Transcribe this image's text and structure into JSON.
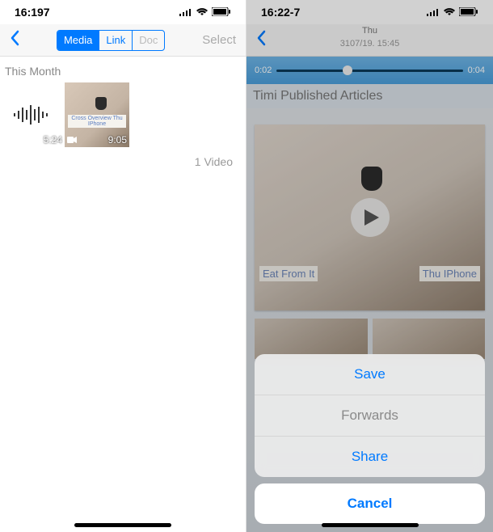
{
  "left": {
    "status": {
      "time": "16:197"
    },
    "nav": {
      "segments": [
        "Media",
        "Link",
        "Doc"
      ],
      "select_label": "Select"
    },
    "section": "This Month",
    "thumbs": {
      "audio_duration": "5:24",
      "video_duration": "9:05",
      "video_banner": "Cross Overview Thu IPhone"
    },
    "summary": "1 Video"
  },
  "right": {
    "status": {
      "time": "16:22-7"
    },
    "nav": {
      "title": "Thu",
      "subtitle": "3107/19. 15:45"
    },
    "scrub": {
      "elapsed": "0:02",
      "remain": "0:04",
      "progress_pct": 38
    },
    "article_title": "Timi Published Articles",
    "hero": {
      "caption_left": "Eat From It",
      "caption_right": "Thu IPhone"
    },
    "sheet": {
      "save": "Save",
      "forwards": "Forwards",
      "share": "Share",
      "cancel": "Cancel"
    }
  }
}
